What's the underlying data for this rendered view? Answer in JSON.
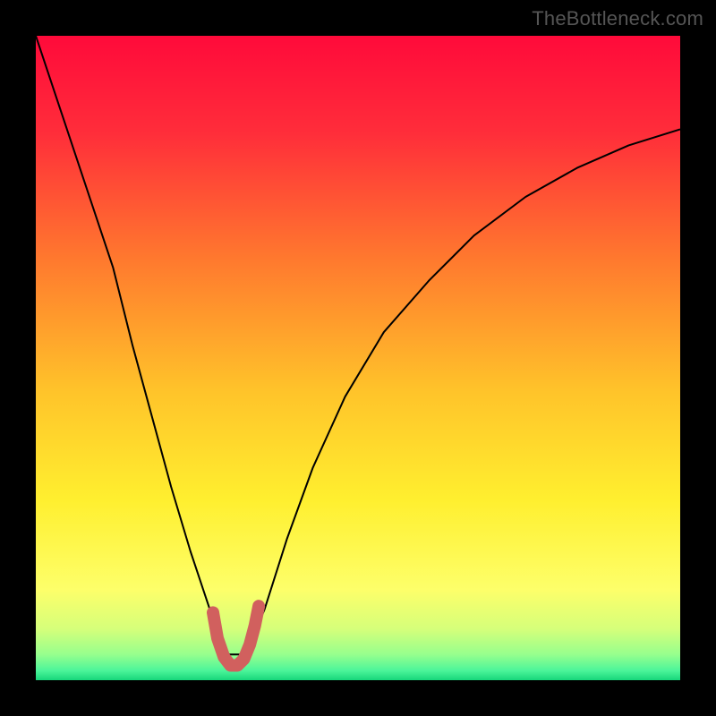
{
  "watermark": "TheBottleneck.com",
  "chart_data": {
    "type": "line",
    "title": "",
    "xlabel": "",
    "ylabel": "",
    "xlim": [
      0,
      100
    ],
    "ylim": [
      0,
      100
    ],
    "gradient_stops": [
      {
        "offset": 0,
        "color": "#ff0a3a"
      },
      {
        "offset": 0.15,
        "color": "#ff2d3a"
      },
      {
        "offset": 0.35,
        "color": "#ff7a2e"
      },
      {
        "offset": 0.55,
        "color": "#ffc32a"
      },
      {
        "offset": 0.72,
        "color": "#ffef2f"
      },
      {
        "offset": 0.86,
        "color": "#fdff6a"
      },
      {
        "offset": 0.92,
        "color": "#d6ff7a"
      },
      {
        "offset": 0.96,
        "color": "#97ff8d"
      },
      {
        "offset": 0.985,
        "color": "#4cf59a"
      },
      {
        "offset": 1,
        "color": "#17d67a"
      }
    ],
    "series": [
      {
        "name": "bottleneck-curve",
        "stroke": "#000000",
        "stroke_width": 2,
        "x": [
          0,
          4,
          8,
          12,
          15,
          18,
          21,
          24,
          27,
          29.5,
          32.5,
          35.5,
          39,
          43,
          48,
          54,
          61,
          68,
          76,
          84,
          92,
          100
        ],
        "values": [
          100,
          88,
          76,
          64,
          52,
          41,
          30,
          20,
          11,
          4,
          4,
          11,
          22,
          33,
          44,
          54,
          62,
          69,
          75,
          79.5,
          83,
          85.5
        ]
      },
      {
        "name": "optimal-zone-marker",
        "stroke": "#d1605e",
        "stroke_width": 14,
        "linecap": "round",
        "x": [
          27.5,
          28.2,
          29.2,
          30.2,
          31.3,
          32.3,
          33.2,
          34.0,
          34.6
        ],
        "values": [
          10.5,
          6.5,
          3.6,
          2.3,
          2.3,
          3.3,
          5.5,
          8.5,
          11.5
        ]
      }
    ]
  }
}
